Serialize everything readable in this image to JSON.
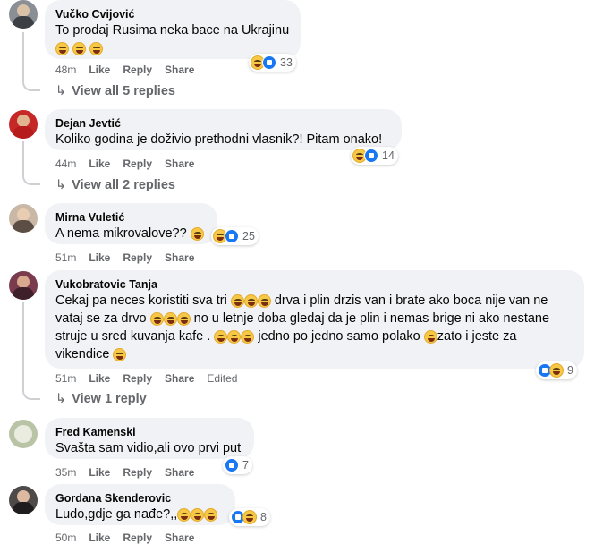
{
  "comments": [
    {
      "name": "Vučko Cvijović",
      "text": "To prodaj Rusima neka bace na Ukrajinu",
      "time": "48m",
      "like": "Like",
      "reply": "Reply",
      "share": "Share",
      "reaction_count": "33",
      "replies": "View all 5 replies",
      "avatar_color": "#8a8f96"
    },
    {
      "name": "Dejan Jevtić",
      "text": "Koliko godina je doživio prethodni vlasnik?! Pitam onako!",
      "time": "44m",
      "like": "Like",
      "reply": "Reply",
      "share": "Share",
      "reaction_count": "14",
      "replies": "View all 2 replies",
      "avatar_color": "#c62828"
    },
    {
      "name": "Mirna Vuletić",
      "text": "A nema mikrovalove??",
      "time": "51m",
      "like": "Like",
      "reply": "Reply",
      "share": "Share",
      "reaction_count": "25",
      "avatar_color": "#9e8c7a"
    },
    {
      "name": "Vukobratovic Tanja",
      "text_line1": "Cekaj pa neces koristiti sva tri",
      "text_line1b": "drva i plin drzis van i brate ako boca nije van ne",
      "text_line2a": "vataj se za drvo",
      "text_line2b": "no u letnje doba gledaj da je plin i nemas brige ni ako nestane",
      "text_line3a": "struje u sred kuvanja kafe .",
      "text_line3b": "jedno po jedno samo polako",
      "text_line3c": "zato i jeste za",
      "text_line4": "vikendice",
      "time": "51m",
      "like": "Like",
      "reply": "Reply",
      "share": "Share",
      "edited": "Edited",
      "reaction_count": "9",
      "replies": "View 1 reply",
      "avatar_color": "#7a3b4f"
    },
    {
      "name": "Fred Kamenski",
      "text": "Svašta sam vidio,ali ovo prvi put",
      "time": "35m",
      "like": "Like",
      "reply": "Reply",
      "share": "Share",
      "reaction_count": "7",
      "avatar_color": "#b9c4a6"
    },
    {
      "name": "Gordana Skenderovic",
      "text": "Ludo,gdje ga nađe?,,",
      "time": "50m",
      "like": "Like",
      "reply": "Reply",
      "share": "Share",
      "reaction_count": "8",
      "avatar_color": "#4e4a4a"
    }
  ],
  "colors": {
    "bubble": "#f0f2f5",
    "meta": "#65676b",
    "like_blue": "#1877f2"
  }
}
